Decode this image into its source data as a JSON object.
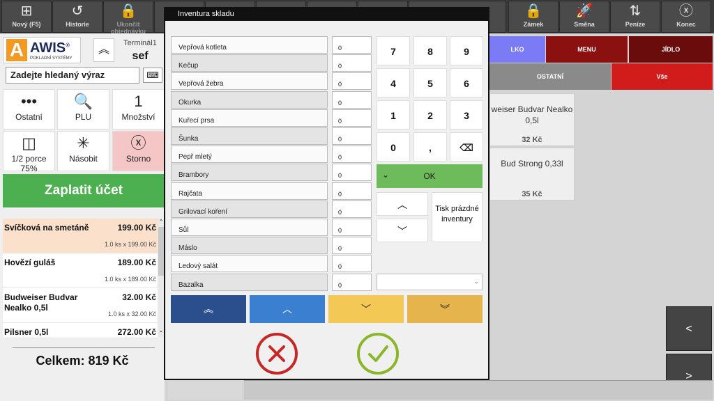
{
  "toolbar": {
    "buttons": [
      {
        "label": "Nový (F5)",
        "icon": "new-icon",
        "glyph": "⊞"
      },
      {
        "label": "Historie",
        "icon": "history-icon",
        "glyph": "↺"
      },
      {
        "label": "Ukončit objednávku",
        "icon": "lock-icon",
        "glyph": "🔒"
      },
      {
        "label": "",
        "icon": "hidden-icon",
        "glyph": ""
      },
      {
        "label": "",
        "icon": "hidden-icon",
        "glyph": ""
      },
      {
        "label": "",
        "icon": "hidden-icon",
        "glyph": ""
      },
      {
        "label": "",
        "icon": "hidden-icon",
        "glyph": ""
      },
      {
        "label": "",
        "icon": "hidden-icon",
        "glyph": ""
      },
      {
        "label": "",
        "icon": "hidden-icon",
        "glyph": ""
      },
      {
        "label": "Zámek",
        "icon": "lock-icon",
        "glyph": "🔒"
      },
      {
        "label": "Směna",
        "icon": "rocket-icon",
        "glyph": "🚀"
      },
      {
        "label": "Peníze",
        "icon": "money-transfer-icon",
        "glyph": "⇅"
      },
      {
        "label": "Konec",
        "icon": "close-icon",
        "glyph": "ⓧ"
      }
    ]
  },
  "left": {
    "logo": {
      "letter": "A",
      "brand": "AWIS",
      "mark": "®",
      "subtitle": "POKLADNÍ SYSTÉMY"
    },
    "terminal": "Terminál1",
    "user": "sef",
    "search_placeholder": "Zadejte hledaný výraz",
    "functions": [
      {
        "label": "Ostatní",
        "glyph": "•••",
        "icon": "more-icon"
      },
      {
        "label": "PLU",
        "glyph": "🔍",
        "icon": "search-icon"
      },
      {
        "label": "Množství",
        "glyph": "1",
        "icon": "quantity-icon"
      },
      {
        "label": "1/2 porce 75%",
        "glyph": "◫",
        "icon": "half-portion-icon"
      },
      {
        "label": "Násobit",
        "glyph": "✳",
        "icon": "multiply-icon"
      },
      {
        "label": "Storno",
        "glyph": "ⓧ",
        "icon": "cancel-icon"
      }
    ],
    "pay_label": "Zaplatit účet",
    "order_items": [
      {
        "name": "Svíčková na smetáně",
        "price": "199.00 Kč",
        "detail": "1.0 ks x 199.00 Kč"
      },
      {
        "name": "Hovězí guláš",
        "price": "189.00 Kč",
        "detail": "1.0 ks x 189.00 Kč"
      },
      {
        "name": "Budweiser Budvar Nealko 0,5l",
        "price": "32.00 Kč",
        "detail": "1.0 ks x 32.00 Kč"
      },
      {
        "name": "Pilsner 0,5l",
        "price": "272.00 Kč",
        "detail": ""
      }
    ],
    "total": "Celkem: 819 Kč"
  },
  "right": {
    "categories": [
      {
        "label": "LKO",
        "color": "#7b7bf5"
      },
      {
        "label": "MENU",
        "color": "#8b1010"
      },
      {
        "label": "JÍDLO",
        "color": "#6b0c0c"
      },
      {
        "label": "OSTATNÍ",
        "color": "#8a8a8a"
      },
      {
        "label": "Vše",
        "color": "#d21b1b"
      }
    ],
    "products": [
      {
        "name": "weiser Budvar Nealko 0,5l",
        "price": "32 Kč"
      },
      {
        "name": "Bud Strong 0,33l",
        "price": "35 Kč"
      }
    ],
    "nav": {
      "prev": "<",
      "next": ">"
    }
  },
  "dialog": {
    "title": "Inventura skladu",
    "items": [
      {
        "name": "Vepřová kotleta",
        "value": "0"
      },
      {
        "name": "Kečup",
        "value": "0"
      },
      {
        "name": "Vepřová žebra",
        "value": "0"
      },
      {
        "name": "Okurka",
        "value": "0"
      },
      {
        "name": "Kuřecí prsa",
        "value": "0"
      },
      {
        "name": "Šunka",
        "value": "0"
      },
      {
        "name": "Pepř mletý",
        "value": "0"
      },
      {
        "name": "Brambory",
        "value": "0"
      },
      {
        "name": "Rajčata",
        "value": "0"
      },
      {
        "name": "Grilovací koření",
        "value": "0"
      },
      {
        "name": "Sůl",
        "value": "0"
      },
      {
        "name": "Máslo",
        "value": "0"
      },
      {
        "name": "Ledový salát",
        "value": "0"
      },
      {
        "name": "Bazalka",
        "value": "0"
      }
    ],
    "numpad": [
      "7",
      "8",
      "9",
      "4",
      "5",
      "6",
      "1",
      "2",
      "3",
      "0",
      ",",
      "⌫"
    ],
    "ok_label": "OK",
    "print_empty_label": "Tisk prázdné inventury",
    "page_colors": [
      "#2b4e8c",
      "#3a7fd0",
      "#f4c855",
      "#e6b44c"
    ]
  }
}
